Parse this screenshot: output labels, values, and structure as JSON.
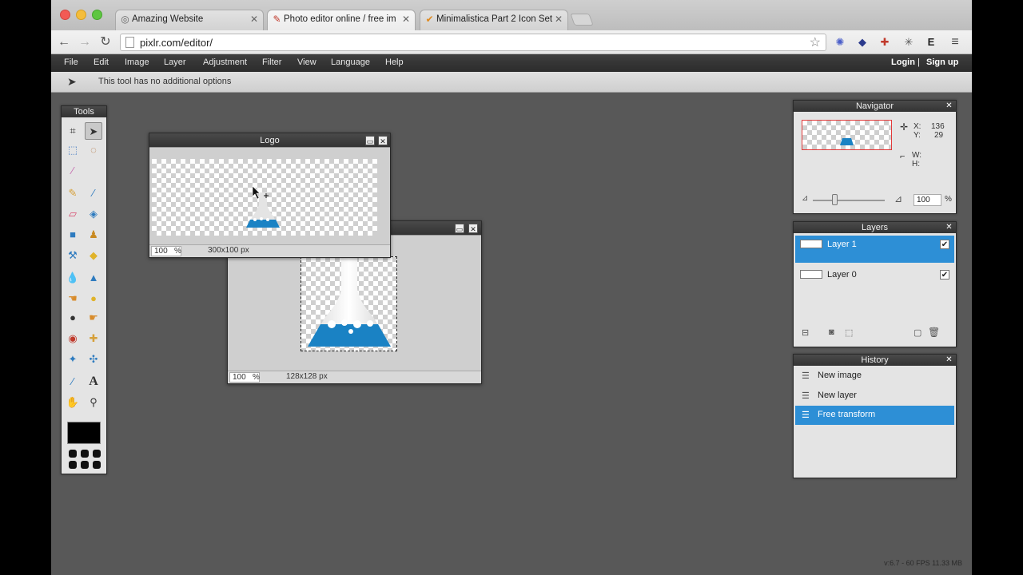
{
  "browser": {
    "tabs": [
      {
        "title": "Amazing Website",
        "active": false
      },
      {
        "title": "Photo editor online / free im",
        "active": true
      },
      {
        "title": "Minimalistica Part 2 Icon Set",
        "active": false
      }
    ],
    "url": "pixlr.com/editor/"
  },
  "menu": {
    "items": [
      "File",
      "Edit",
      "Image",
      "Layer",
      "Adjustment",
      "Filter",
      "View",
      "Language",
      "Help"
    ],
    "login": "Login",
    "separator": "|",
    "signup": "Sign up"
  },
  "options": {
    "message": "This tool has no additional options"
  },
  "tools": {
    "title": "Tools",
    "foreground_color": "#000000"
  },
  "docs": {
    "logo": {
      "title": "Logo",
      "zoom": "100",
      "zoom_unit": "%",
      "size": "300x100 px"
    },
    "flask": {
      "title": "",
      "zoom": "100",
      "zoom_unit": "%",
      "size": "128x128 px"
    }
  },
  "navigator": {
    "title": "Navigator",
    "x_label": "X:",
    "x_value": "136",
    "y_label": "Y:",
    "y_value": "29",
    "w_label": "W:",
    "h_label": "H:",
    "zoom": "100",
    "zoom_unit": "%"
  },
  "layers": {
    "title": "Layers",
    "items": [
      {
        "name": "Layer 1",
        "selected": true,
        "visible": true
      },
      {
        "name": "Layer 0",
        "selected": false,
        "visible": true
      }
    ]
  },
  "history": {
    "title": "History",
    "items": [
      {
        "label": "New image",
        "selected": false
      },
      {
        "label": "New layer",
        "selected": false
      },
      {
        "label": "Free transform",
        "selected": true
      }
    ]
  },
  "status": {
    "fps": "v:6.7 - 60 FPS 11.33 MB"
  },
  "colors": {
    "accent": "#2d8fd6",
    "flask_blue": "#1a82c4"
  }
}
